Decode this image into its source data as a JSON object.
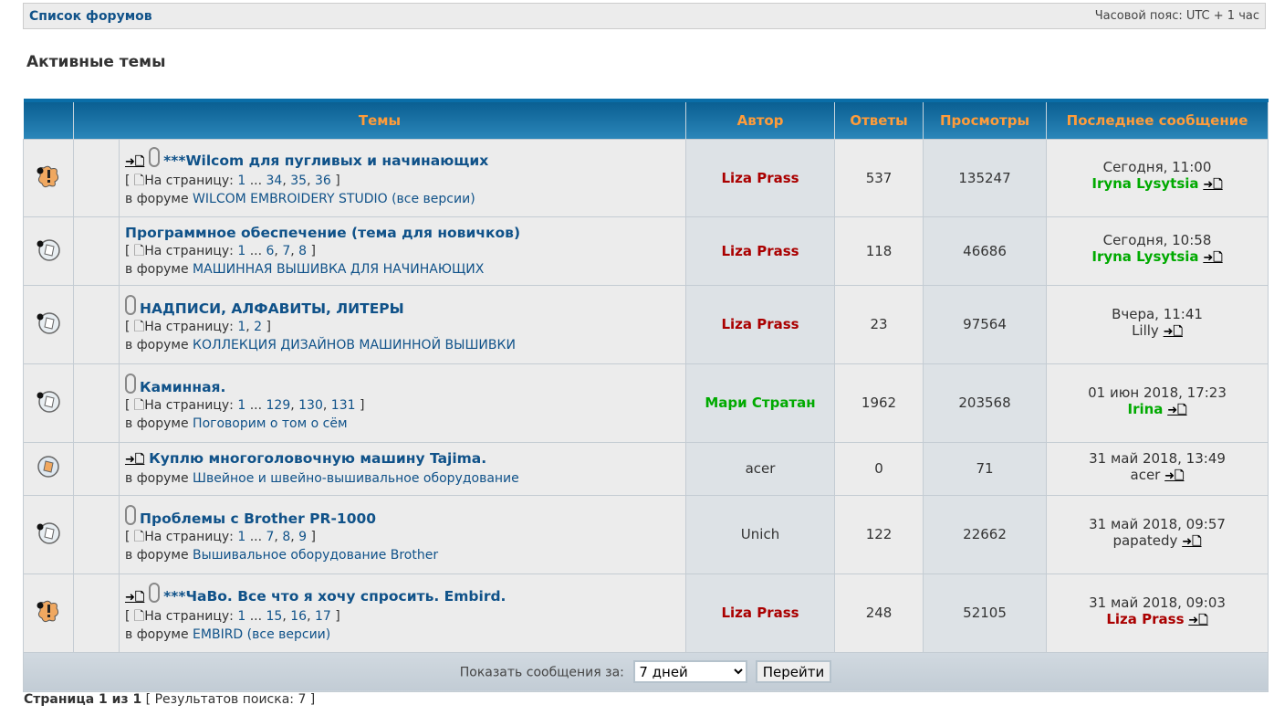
{
  "nav": {
    "forum_list": "Список форумов",
    "timezone": "Часовой пояс: UTC + 1 час"
  },
  "page_title": "Активные темы",
  "headers": {
    "topics": "Темы",
    "author": "Автор",
    "replies": "Ответы",
    "views": "Просмотры",
    "last": "Последнее сообщение"
  },
  "labels": {
    "on_page": "На страницу:",
    "in_forum": "в форуме"
  },
  "rows": [
    {
      "icon": "hot-topic-icon",
      "newpost": true,
      "clip": true,
      "title": "***Wilcom для пугливых и начинающих",
      "pages": [
        "1",
        "...",
        "34",
        "35",
        "36"
      ],
      "forum": "WILCOM EMBROIDERY STUDIO (все версии)",
      "author": "Liza Prass",
      "author_color": "red",
      "replies": "537",
      "views": "135247",
      "last_time": "Сегодня, 11:00",
      "last_user": "Iryna Lysytsia",
      "last_color": "green"
    },
    {
      "icon": "topic-icon",
      "newpost": false,
      "clip": false,
      "title": "Программное обеспечение (тема для новичков)",
      "pages": [
        "1",
        "...",
        "6",
        "7",
        "8"
      ],
      "forum": "МАШИННАЯ ВЫШИВКА ДЛЯ НАЧИНАЮЩИХ",
      "author": "Liza Prass",
      "author_color": "red",
      "replies": "118",
      "views": "46686",
      "last_time": "Сегодня, 10:58",
      "last_user": "Iryna Lysytsia",
      "last_color": "green"
    },
    {
      "icon": "topic-icon",
      "newpost": false,
      "clip": true,
      "title": "НАДПИСИ, АЛФАВИТЫ, ЛИТЕРЫ",
      "pages": [
        "1",
        "2"
      ],
      "forum": "КОЛЛЕКЦИЯ ДИЗАЙНОВ МАШИННОЙ ВЫШИВКИ",
      "author": "Liza Prass",
      "author_color": "red",
      "replies": "23",
      "views": "97564",
      "last_time": "Вчера, 11:41",
      "last_user": "Lilly",
      "last_color": "norm"
    },
    {
      "icon": "topic-icon",
      "newpost": false,
      "clip": true,
      "title": "Каминная.",
      "pages": [
        "1",
        "...",
        "129",
        "130",
        "131"
      ],
      "forum": "Поговорим о том о сём",
      "author": "Мари Стратан",
      "author_color": "green",
      "replies": "1962",
      "views": "203568",
      "last_time": "01 июн 2018, 17:23",
      "last_user": "Irina",
      "last_color": "green"
    },
    {
      "icon": "unread-topic-icon",
      "newpost": true,
      "clip": false,
      "title": "Куплю многоголовочную машину Tajima.",
      "pages": [],
      "forum": "Швейное и швейно-вышивальное оборудование",
      "author": "acer",
      "author_color": "norm",
      "replies": "0",
      "views": "71",
      "last_time": "31 май 2018, 13:49",
      "last_user": "acer",
      "last_color": "norm"
    },
    {
      "icon": "topic-icon",
      "newpost": false,
      "clip": true,
      "title": "Проблемы с Brother PR-1000",
      "pages": [
        "1",
        "...",
        "7",
        "8",
        "9"
      ],
      "forum": "Вышивальное оборудование Brother",
      "author": "Unich",
      "author_color": "norm",
      "replies": "122",
      "views": "22662",
      "last_time": "31 май 2018, 09:57",
      "last_user": "papatedy",
      "last_color": "norm"
    },
    {
      "icon": "hot-topic-icon",
      "newpost": true,
      "clip": true,
      "title": "***ЧаВо. Все что я хочу спросить. Embird.",
      "pages": [
        "1",
        "...",
        "15",
        "16",
        "17"
      ],
      "forum": "EMBIRD (все версии)",
      "author": "Liza Prass",
      "author_color": "red",
      "replies": "248",
      "views": "52105",
      "last_time": "31 май 2018, 09:03",
      "last_user": "Liza Prass",
      "last_color": "red"
    }
  ],
  "footer": {
    "show_label": "Показать сообщения за:",
    "period": "7 дней",
    "go": "Перейти"
  },
  "pagination": {
    "page": "Страница 1 из 1",
    "results": "[ Результатов поиска: 7 ]"
  }
}
